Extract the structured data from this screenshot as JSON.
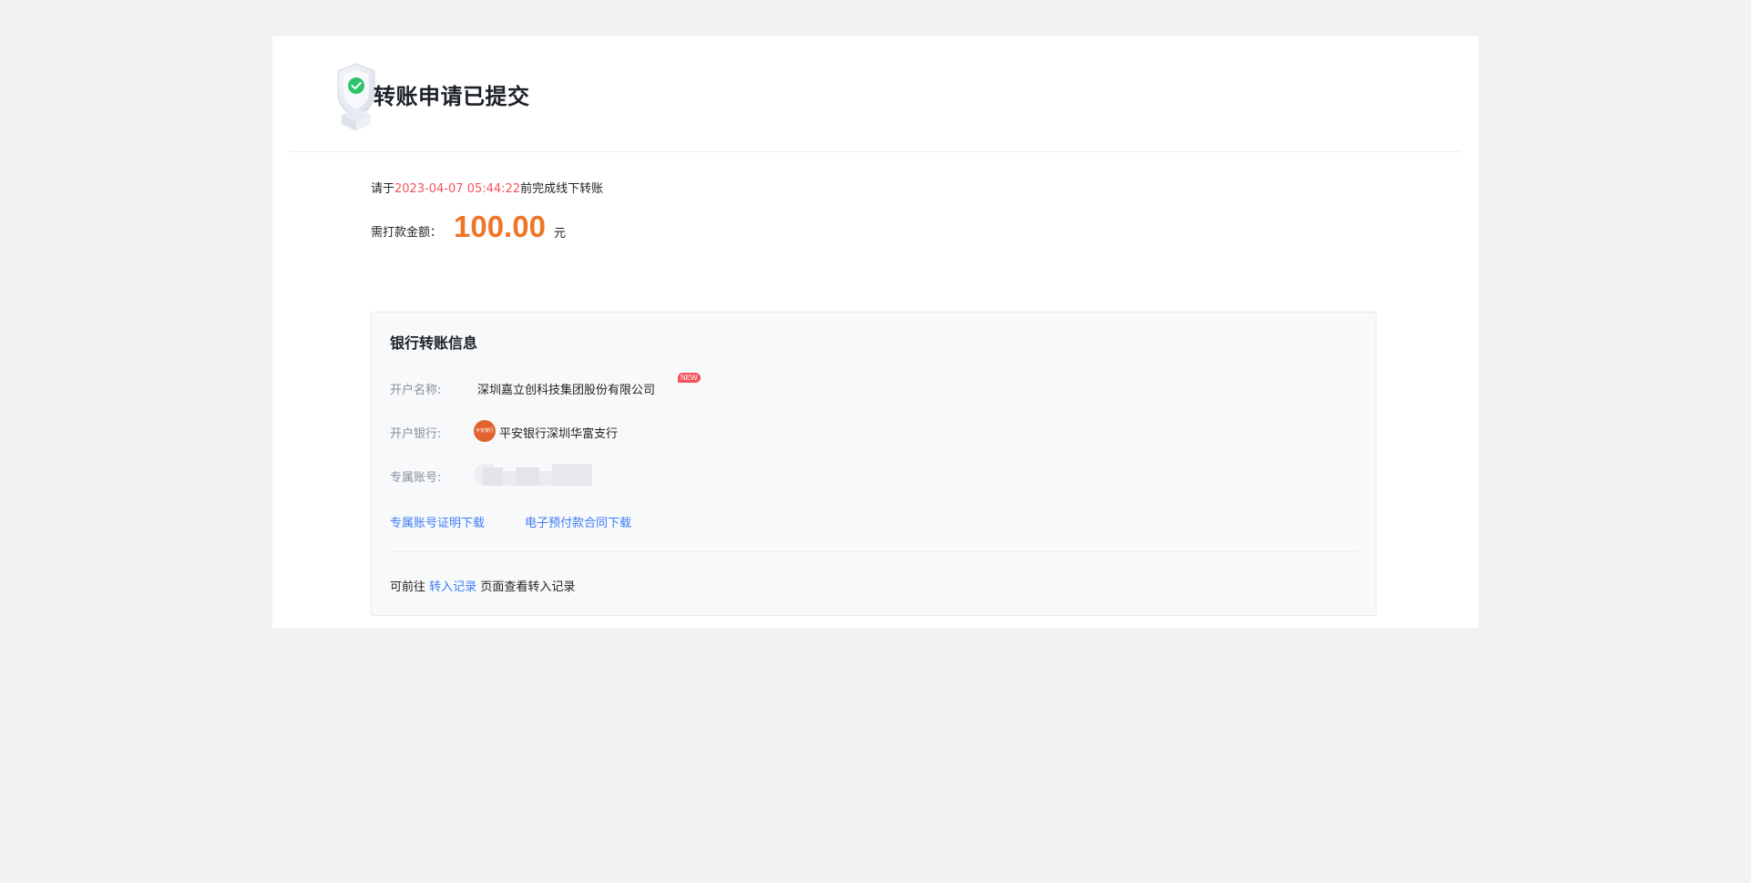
{
  "header": {
    "title": "转账申请已提交"
  },
  "deadline": {
    "prefix": "请于",
    "datetime": "2023-04-07 05:44:22",
    "suffix": "前完成线下转账"
  },
  "amount": {
    "label": "需打款金额：",
    "value": "100.00",
    "unit": "元"
  },
  "bank_info": {
    "title": "银行转账信息",
    "account_name_label": "开户名称:",
    "account_name": "深圳嘉立创科技集团股份有限公司",
    "new_badge": "NEW",
    "bank_label": "开户银行:",
    "bank_logo_text": "平安银行",
    "bank_name": "平安银行深圳华富支行",
    "account_no_label": "专属账号:",
    "links": {
      "certificate": "专属账号证明下载",
      "contract": "电子预付款合同下载"
    }
  },
  "footer": {
    "prefix": "可前往",
    "link": "转入记录",
    "suffix": "页面查看转入记录"
  },
  "colors": {
    "accent_red": "#f2545b",
    "amount_orange": "#f07527",
    "link_blue": "#3b7cf5",
    "success_green": "#2cc46d"
  },
  "icons": {
    "hero": "shield-check-icon",
    "bank": "ping-an-bank-logo"
  }
}
